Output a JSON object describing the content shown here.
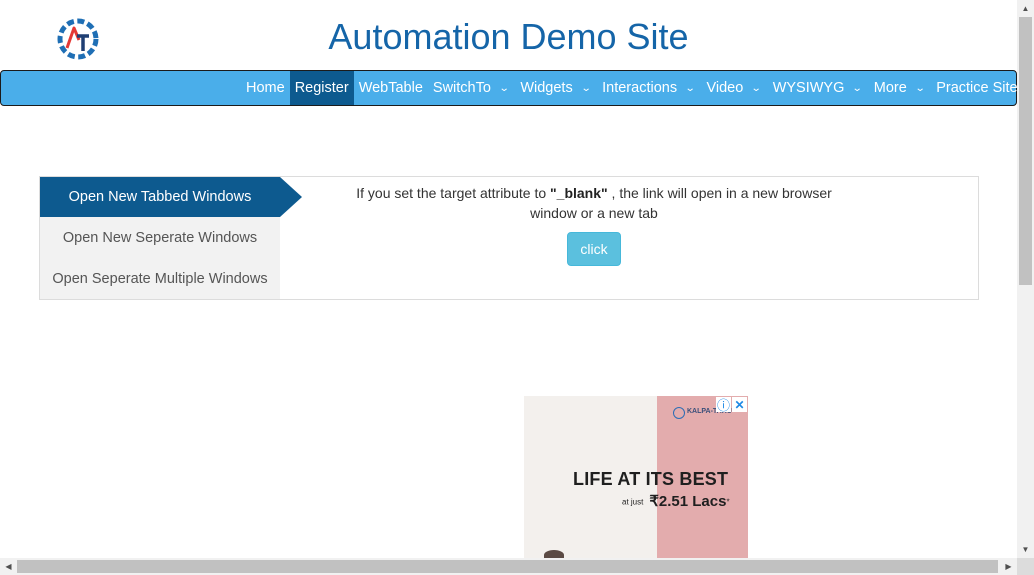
{
  "header": {
    "title": "Automation Demo Site",
    "logo_icon": "gear-logo-icon",
    "logo_text": "AT"
  },
  "nav": {
    "items": [
      {
        "label": "Home",
        "dropdown": false,
        "active": false
      },
      {
        "label": "Register",
        "dropdown": false,
        "active": true
      },
      {
        "label": "WebTable",
        "dropdown": false,
        "active": false
      },
      {
        "label": "SwitchTo",
        "dropdown": true,
        "active": false
      },
      {
        "label": "Widgets",
        "dropdown": true,
        "active": false
      },
      {
        "label": "Interactions",
        "dropdown": true,
        "active": false
      },
      {
        "label": "Video",
        "dropdown": true,
        "active": false
      },
      {
        "label": "WYSIWYG",
        "dropdown": true,
        "active": false
      },
      {
        "label": "More",
        "dropdown": true,
        "active": false
      },
      {
        "label": "Practice Site",
        "dropdown": false,
        "active": false
      }
    ]
  },
  "tabs": [
    {
      "label": "Open New Tabbed Windows",
      "active": true
    },
    {
      "label": "Open New Seperate Windows",
      "active": false
    },
    {
      "label": "Open Seperate Multiple Windows",
      "active": false
    }
  ],
  "content": {
    "text_before": "If you set the target attribute to ",
    "highlight": "\"_blank\"",
    "text_after": " , the link will open in a new browser window or a new tab",
    "button_label": "click"
  },
  "ad": {
    "brand": "KALPA-TARU",
    "headline": "LIFE AT ITS BEST",
    "sub_small": "at just",
    "sub_price": "₹2.51 Lacs",
    "sub_mark": "*",
    "info_icon": "ⓘ",
    "close_icon": "✕"
  },
  "colors": {
    "title": "#1565a8",
    "navbar": "#4aaeea",
    "active": "#0d5a8f",
    "button": "#5bc0de"
  }
}
